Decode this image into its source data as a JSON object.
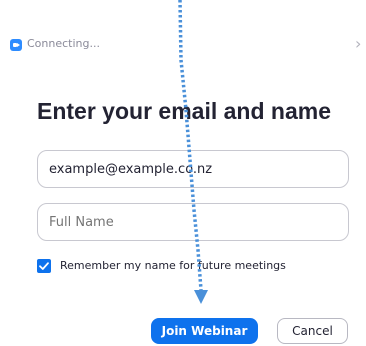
{
  "window": {
    "status_text": "Connecting...",
    "chevron_symbol": "›"
  },
  "dialog": {
    "heading": "Enter your email and name",
    "email_value": "example@example.co.nz",
    "name_placeholder": "Full Name",
    "remember_checked": true,
    "remember_label": "Remember my name for future meetings",
    "join_label": "Join Webinar",
    "cancel_label": "Cancel"
  },
  "colors": {
    "accent": "#0e72ed",
    "annotation_arrow": "#4a90d9"
  },
  "icons": {
    "app": "zoom-camera-icon",
    "check": "checkmark-icon",
    "annotation": "dotted-arrow-down-icon"
  }
}
